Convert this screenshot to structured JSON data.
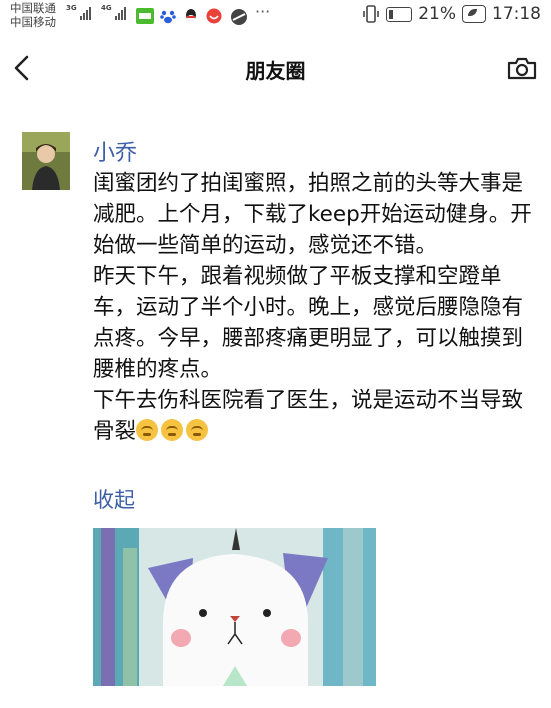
{
  "status_bar": {
    "carrier_1": "中国联通",
    "carrier_2": "中国移动",
    "net_1": "3G",
    "net_2": "4G",
    "more": "···",
    "battery": "21%",
    "time": "17:18"
  },
  "nav": {
    "title": "朋友圈"
  },
  "post": {
    "author": "小乔",
    "lines": [
      "闺蜜团约了拍闺蜜照，拍照之前的头等大事是减肥。上个月，下载了keep开始运动健身。开始做一些简单的运动，感觉还不错。",
      "昨天下午，跟着视频做了平板支撑和空蹬单车，运动了半个小时。晚上，感觉后腰隐隐有点疼。今早，腰部疼痛更明显了，可以触摸到腰椎的疼点。",
      "下午去伤科医院看了医生，说是运动不当导致骨裂"
    ],
    "emojis": [
      "grimace-emoji",
      "grimace-emoji",
      "grimace-emoji"
    ],
    "collapse_label": "收起"
  },
  "colors": {
    "link_blue": "#3c5fa8",
    "text": "#111111"
  }
}
